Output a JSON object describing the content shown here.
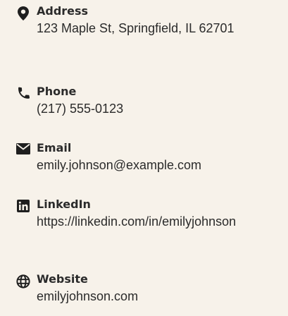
{
  "contact": {
    "items": [
      {
        "key": "address",
        "icon": "map-marker-icon",
        "label": "Address",
        "value": "123 Maple St, Springfield, IL 62701"
      },
      {
        "key": "phone",
        "icon": "phone-icon",
        "label": "Phone",
        "value": "(217) 555-0123"
      },
      {
        "key": "email",
        "icon": "envelope-icon",
        "label": "Email",
        "value": "emily.johnson@example.com"
      },
      {
        "key": "linkedin",
        "icon": "linkedin-icon",
        "label": "LinkedIn",
        "value": "https://linkedin.com/in/emilyjohnson"
      },
      {
        "key": "website",
        "icon": "globe-icon",
        "label": "Website",
        "value": "emilyjohnson.com"
      }
    ]
  },
  "colors": {
    "background": "#f7f2ea",
    "text": "#2b2b2b",
    "icon": "#1f1f1f"
  }
}
